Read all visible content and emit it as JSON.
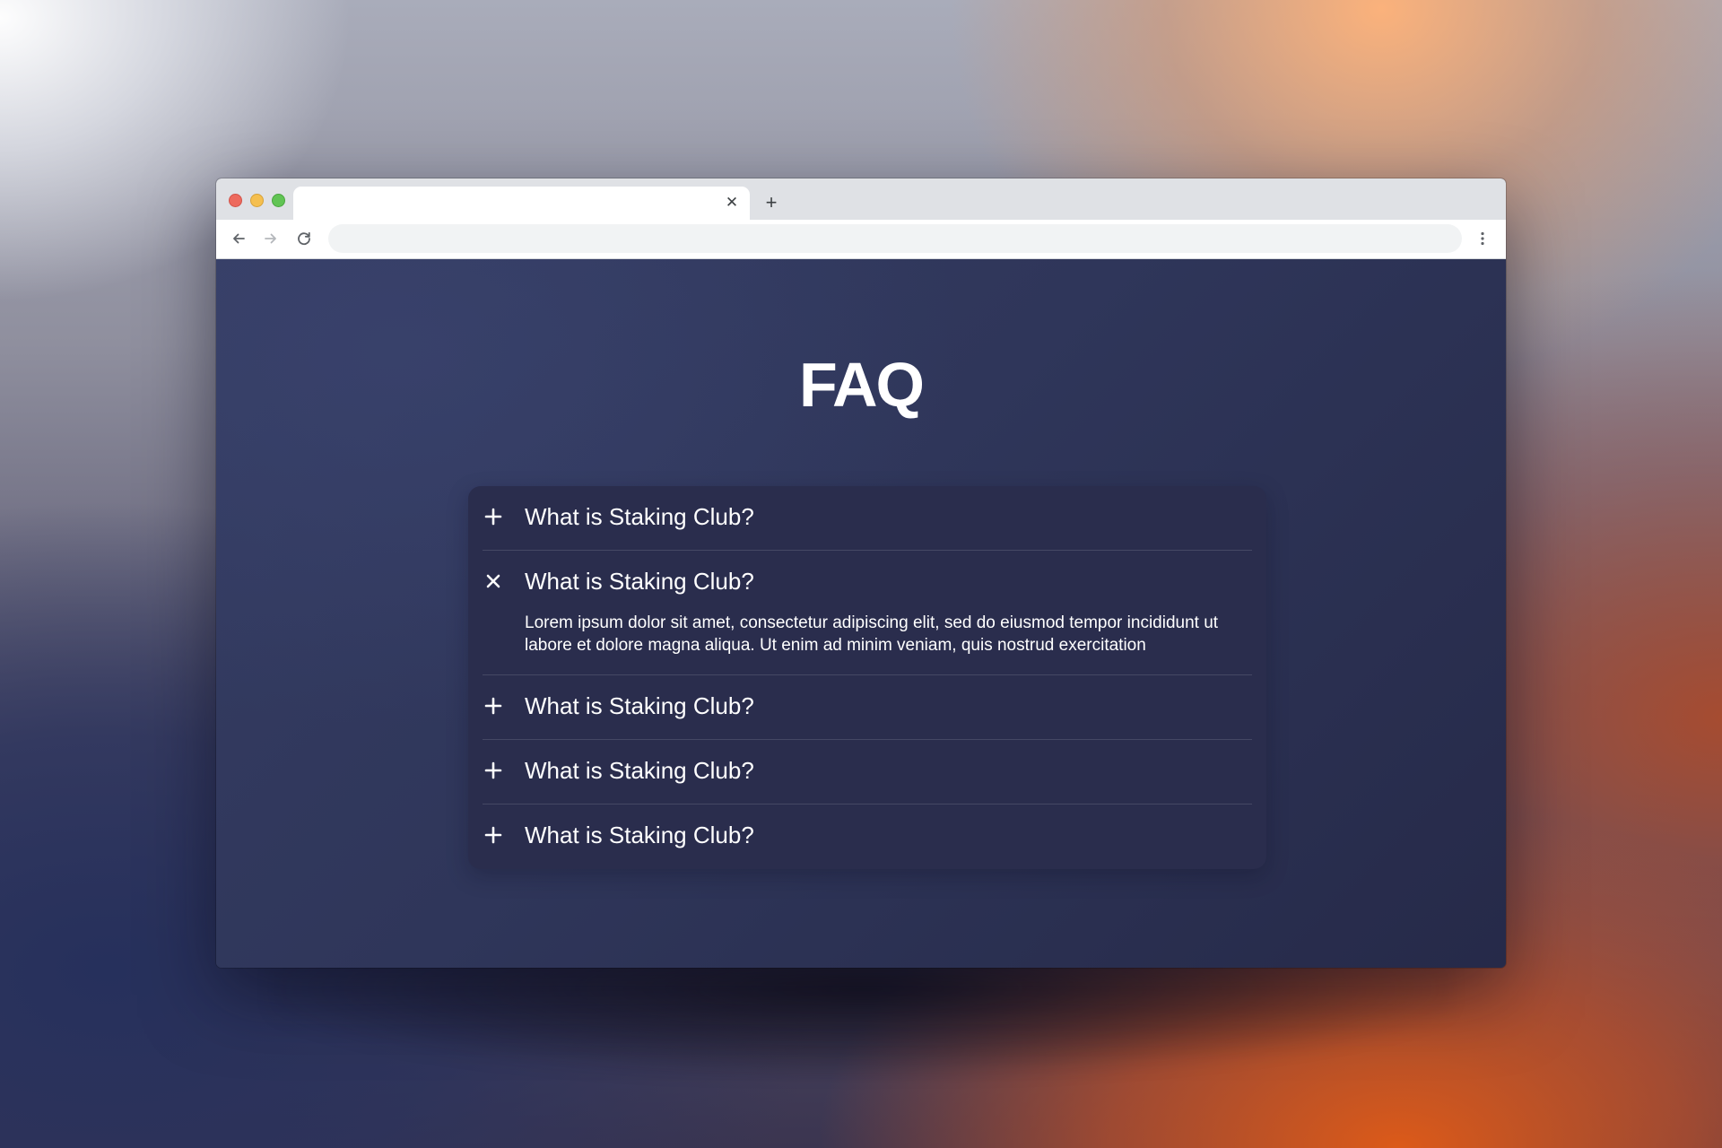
{
  "browser": {
    "tab": {
      "title": "",
      "close_icon": "close-icon"
    },
    "new_tab_icon": "plus-icon",
    "toolbar": {
      "back_icon": "arrow-left-icon",
      "forward_icon": "arrow-right-icon",
      "reload_icon": "reload-icon",
      "address_value": "",
      "menu_icon": "kebab-menu-icon"
    },
    "window_controls": {
      "close_color": "#ed6a5e",
      "minimize_color": "#f5bf4f",
      "zoom_color": "#61c454"
    }
  },
  "page": {
    "title": "FAQ",
    "colors": {
      "background": "#2f365a",
      "panel": "#2a2d4d",
      "text": "#ffffff"
    },
    "faq": {
      "items": [
        {
          "question": "What is Staking Club?",
          "expanded": false,
          "icon": "plus-icon"
        },
        {
          "question": "What is Staking Club?",
          "expanded": true,
          "icon": "close-icon",
          "answer": "Lorem ipsum dolor sit amet, consectetur adipiscing elit, sed do eiusmod tempor incididunt ut labore et dolore magna aliqua. Ut enim ad minim veniam, quis nostrud exercitation"
        },
        {
          "question": "What is Staking Club?",
          "expanded": false,
          "icon": "plus-icon"
        },
        {
          "question": "What is Staking Club?",
          "expanded": false,
          "icon": "plus-icon"
        },
        {
          "question": "What is Staking Club?",
          "expanded": false,
          "icon": "plus-icon"
        }
      ]
    }
  }
}
